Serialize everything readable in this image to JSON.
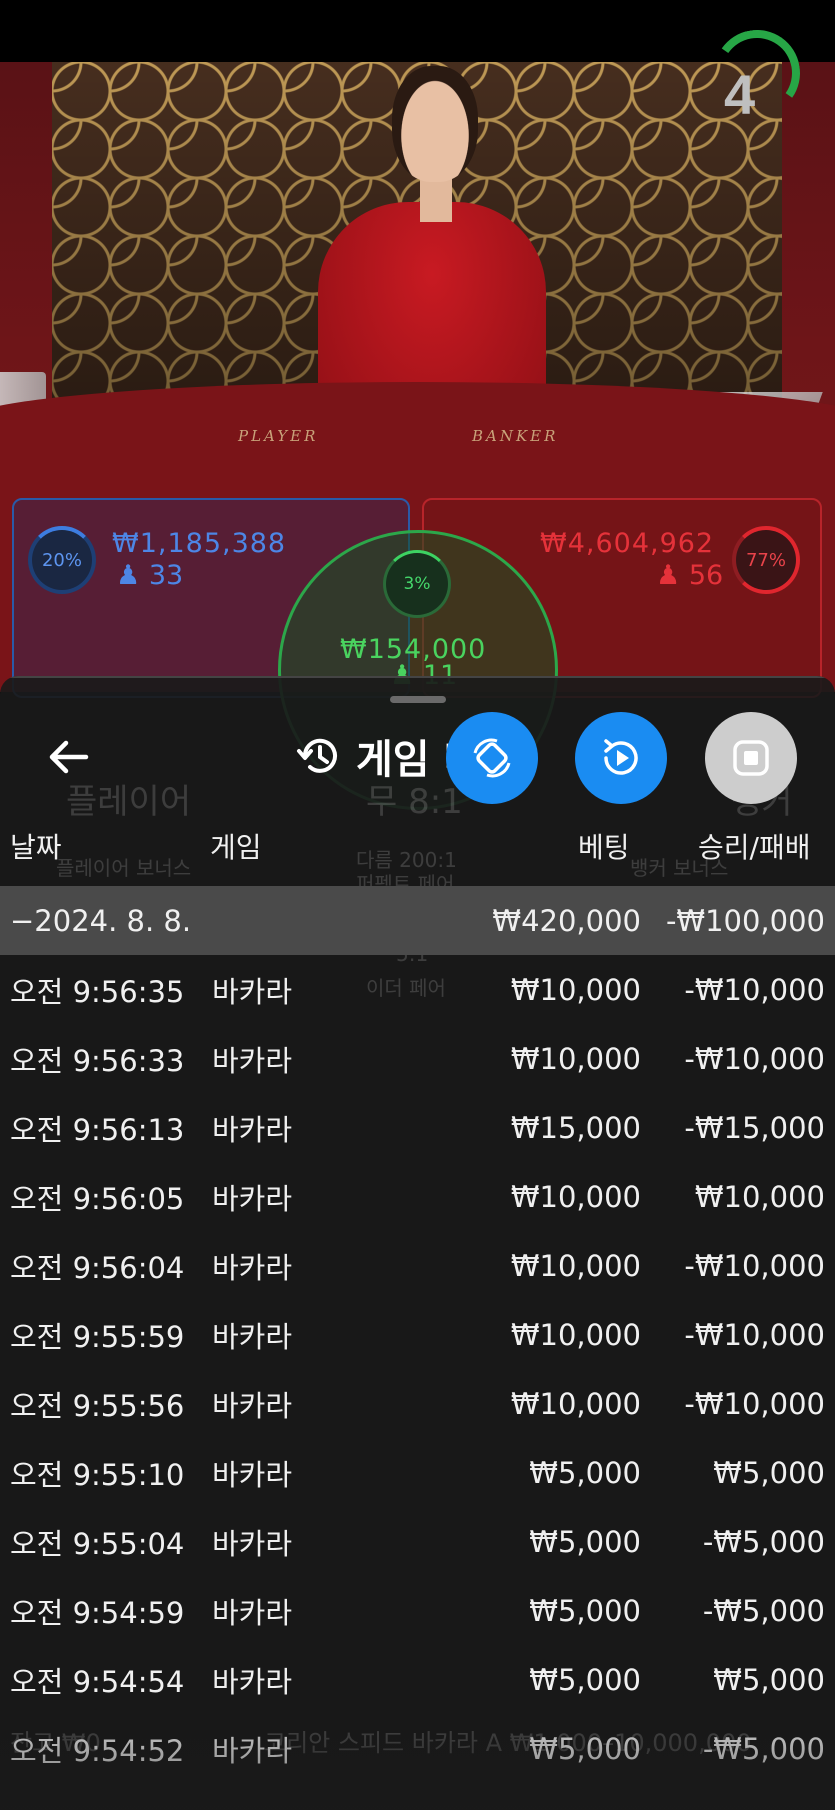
{
  "video": {
    "countdown": "4",
    "felt_player": "PLAYER",
    "felt_banker": "BANKER"
  },
  "board": {
    "player": {
      "percent": "20%",
      "amount": "₩1,185,388",
      "count": "33"
    },
    "tie": {
      "percent": "3%",
      "amount": "₩154,000",
      "count": "11"
    },
    "banker": {
      "percent": "77%",
      "amount": "₩4,604,962",
      "count": "56"
    }
  },
  "sheet": {
    "title": "게임 내역",
    "columns": {
      "date": "날짜",
      "game": "게임",
      "bet": "베팅",
      "result": "승리/패배"
    },
    "summary": {
      "date": "−2024. 8. 8.",
      "bet": "₩420,000",
      "result": "-₩100,000"
    },
    "rows": [
      {
        "time": "오전 9:56:35",
        "game": "바카라",
        "bet": "₩10,000",
        "result": "-₩10,000"
      },
      {
        "time": "오전 9:56:33",
        "game": "바카라",
        "bet": "₩10,000",
        "result": "-₩10,000"
      },
      {
        "time": "오전 9:56:13",
        "game": "바카라",
        "bet": "₩15,000",
        "result": "-₩15,000"
      },
      {
        "time": "오전 9:56:05",
        "game": "바카라",
        "bet": "₩10,000",
        "result": "₩10,000"
      },
      {
        "time": "오전 9:56:04",
        "game": "바카라",
        "bet": "₩10,000",
        "result": "-₩10,000"
      },
      {
        "time": "오전 9:55:59",
        "game": "바카라",
        "bet": "₩10,000",
        "result": "-₩10,000"
      },
      {
        "time": "오전 9:55:56",
        "game": "바카라",
        "bet": "₩10,000",
        "result": "-₩10,000"
      },
      {
        "time": "오전 9:55:10",
        "game": "바카라",
        "bet": "₩5,000",
        "result": "₩5,000"
      },
      {
        "time": "오전 9:55:04",
        "game": "바카라",
        "bet": "₩5,000",
        "result": "-₩5,000"
      },
      {
        "time": "오전 9:54:59",
        "game": "바카라",
        "bet": "₩5,000",
        "result": "-₩5,000"
      },
      {
        "time": "오전 9:54:54",
        "game": "바카라",
        "bet": "₩5,000",
        "result": "₩5,000"
      },
      {
        "time": "오전 9:54:52",
        "game": "바카라",
        "bet": "₩5,000",
        "result": "-₩5,000"
      }
    ]
  },
  "background_text": {
    "player_label": "플레이어",
    "tie_label": "무 8:1",
    "banker_label": "뱅커",
    "player_bonus": "플레이어 보너스",
    "perfect_pair": "퍼펙트 페어",
    "perfect_pair_odds": "다름 200:1",
    "banker_bonus": "뱅커 보너스",
    "either_pair": "이더 페어",
    "either_pair_odds": "5:1",
    "balance": "잔고 ₩0",
    "table_name": "코리안 스피드 바카라 A  ₩1,000–10,000,000"
  },
  "icons": {
    "back": "arrow-left-icon",
    "history": "history-clock-icon",
    "fb1": "rotate-screen-icon",
    "fb2": "replay-icon",
    "fb3": "stop-icon"
  },
  "colors": {
    "player": "#4d86e6",
    "banker": "#e5323a",
    "tie": "#4ad35f",
    "accent_button": "#1a8cf2",
    "sheet_bg": "#1a1a1a"
  }
}
